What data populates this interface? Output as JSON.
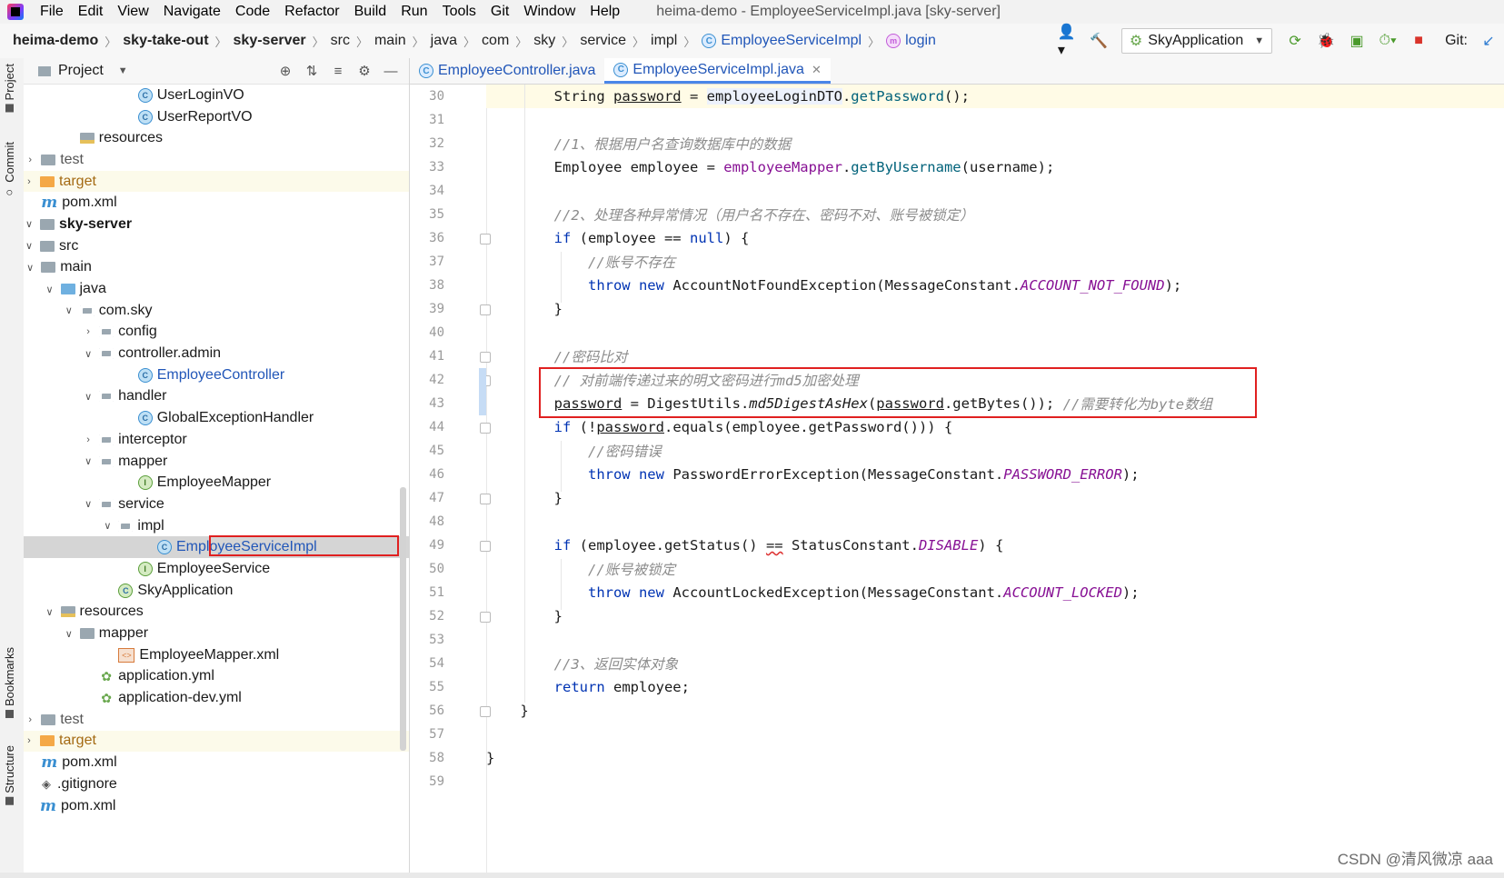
{
  "menubar": {
    "items": [
      "File",
      "Edit",
      "View",
      "Navigate",
      "Code",
      "Refactor",
      "Build",
      "Run",
      "Tools",
      "Git",
      "Window",
      "Help"
    ],
    "window_title": "heima-demo - EmployeeServiceImpl.java [sky-server]"
  },
  "breadcrumbs": [
    "heima-demo",
    "sky-take-out",
    "sky-server",
    "src",
    "main",
    "java",
    "com",
    "sky",
    "service",
    "impl",
    "EmployeeServiceImpl",
    "login"
  ],
  "toolbar": {
    "run_config": "SkyApplication",
    "git_label": "Git:"
  },
  "project_panel": {
    "title": "Project",
    "tree": [
      {
        "label": "UserLoginVO",
        "icon": "class-icon"
      },
      {
        "label": "UserReportVO",
        "icon": "class-icon"
      },
      {
        "label": "resources",
        "icon": "resources-folder-icon"
      },
      {
        "label": "test",
        "icon": "folder-icon"
      },
      {
        "label": "target",
        "icon": "target-folder-icon"
      },
      {
        "label": "pom.xml",
        "icon": "maven-icon"
      },
      {
        "label": "sky-server",
        "icon": "module-folder-icon"
      },
      {
        "label": "src",
        "icon": "folder-icon"
      },
      {
        "label": "main",
        "icon": "folder-icon"
      },
      {
        "label": "java",
        "icon": "source-folder-icon"
      },
      {
        "label": "com.sky",
        "icon": "package-icon"
      },
      {
        "label": "config",
        "icon": "package-icon"
      },
      {
        "label": "controller.admin",
        "icon": "package-icon"
      },
      {
        "label": "EmployeeController",
        "icon": "class-icon"
      },
      {
        "label": "handler",
        "icon": "package-icon"
      },
      {
        "label": "GlobalExceptionHandler",
        "icon": "class-icon"
      },
      {
        "label": "interceptor",
        "icon": "package-icon"
      },
      {
        "label": "mapper",
        "icon": "package-icon"
      },
      {
        "label": "EmployeeMapper",
        "icon": "interface-icon"
      },
      {
        "label": "service",
        "icon": "package-icon"
      },
      {
        "label": "impl",
        "icon": "package-icon"
      },
      {
        "label": "EmployeeServiceImpl",
        "icon": "class-icon"
      },
      {
        "label": "EmployeeService",
        "icon": "interface-icon"
      },
      {
        "label": "SkyApplication",
        "icon": "spring-app-icon"
      },
      {
        "label": "resources",
        "icon": "resources-folder-icon"
      },
      {
        "label": "mapper",
        "icon": "folder-icon"
      },
      {
        "label": "EmployeeMapper.xml",
        "icon": "xml-icon"
      },
      {
        "label": "application.yml",
        "icon": "yml-icon"
      },
      {
        "label": "application-dev.yml",
        "icon": "yml-icon"
      },
      {
        "label": "test",
        "icon": "folder-icon"
      },
      {
        "label": "target",
        "icon": "target-folder-icon"
      },
      {
        "label": "pom.xml",
        "icon": "maven-icon"
      },
      {
        "label": ".gitignore",
        "icon": "git-icon"
      },
      {
        "label": "pom.xml",
        "icon": "maven-icon"
      }
    ]
  },
  "side_tabs": [
    "Project",
    "Commit",
    "Bookmarks",
    "Structure"
  ],
  "editor": {
    "tabs": [
      {
        "label": "EmployeeController.java"
      },
      {
        "label": "EmployeeServiceImpl.java"
      }
    ],
    "line_numbers": [
      "30",
      "31",
      "32",
      "33",
      "34",
      "35",
      "36",
      "37",
      "38",
      "39",
      "40",
      "41",
      "42",
      "43",
      "44",
      "45",
      "46",
      "47",
      "48",
      "49",
      "50",
      "51",
      "52",
      "53",
      "54",
      "55",
      "56",
      "57",
      "58",
      "59"
    ]
  },
  "watermark": "CSDN @清风微凉 aaa"
}
